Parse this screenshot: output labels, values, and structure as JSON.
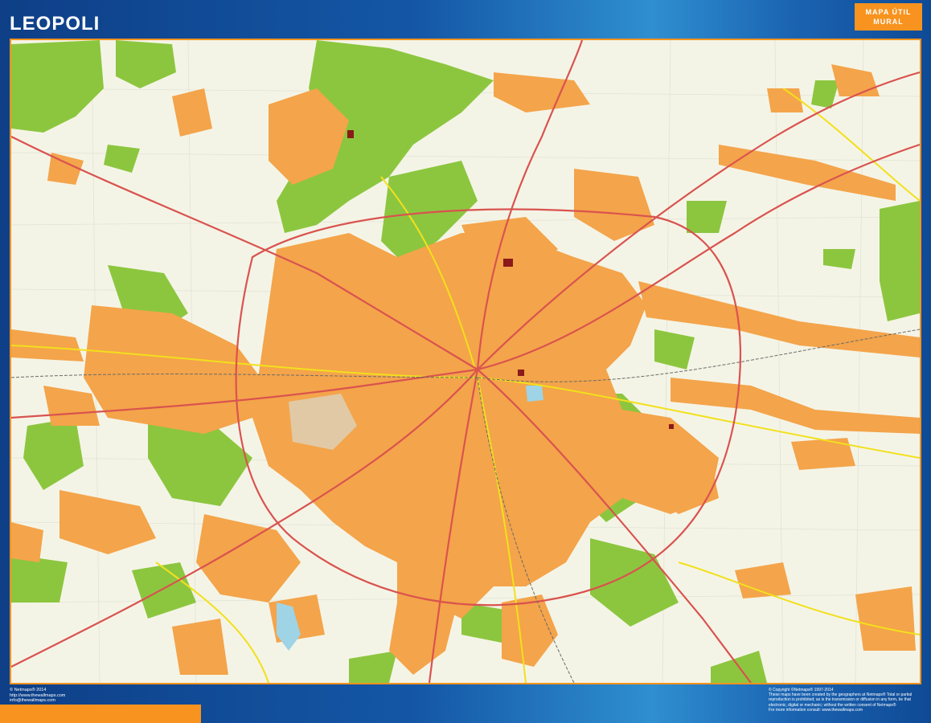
{
  "header": {
    "title": "LEOPOLI",
    "badge_line1": "MAPA ÚTIL",
    "badge_line2": "MURAL"
  },
  "footer": {
    "left_line1": "© Netmaps® 2014",
    "left_line2": "http://www.thewallmaps.com",
    "left_line3": "info@thewallmaps.com",
    "right_line1": "© Copyright ©Netmaps® 1997-2014",
    "right_line2": "These maps have been created by the geographers at Netmaps® Total or partial",
    "right_line3": "reproduction is prohibited; as is the transmission or diffusion in any form, be that",
    "right_line4": "electronic, digital or mechanic; without the written consent of Netmaps®",
    "right_line5": "For more information consult: www.thewallmaps.com"
  },
  "colors": {
    "frame_blue": "#1457a6",
    "accent_orange": "#f7931e",
    "urban": "#f4a44a",
    "park": "#8cc63f",
    "background": "#f4f4e6",
    "road_main": "#d9534f",
    "road_secondary": "#f2e01d",
    "water": "#9fd3e6"
  }
}
